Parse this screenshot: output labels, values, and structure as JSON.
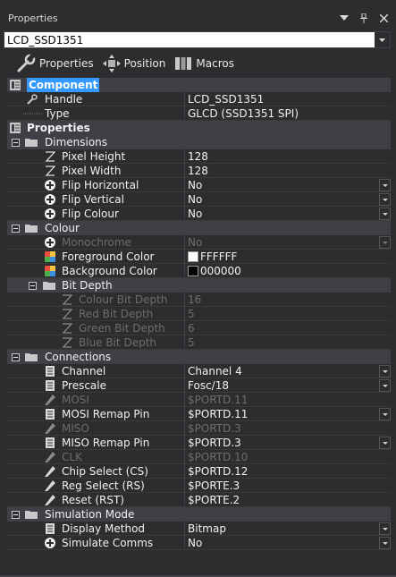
{
  "window": {
    "title": "Properties"
  },
  "selector": {
    "value": "LCD_SSD1351"
  },
  "toolbar": {
    "properties": "Properties",
    "position": "Position",
    "macros": "Macros"
  },
  "component": {
    "label": "Component",
    "handle": {
      "name": "Handle",
      "value": "LCD_SSD1351"
    },
    "type": {
      "name": "Type",
      "value": "GLCD (SSD1351 SPI)"
    }
  },
  "properties": {
    "label": "Properties"
  },
  "dimensions": {
    "label": "Dimensions",
    "pixel_height": {
      "name": "Pixel Height",
      "value": "128"
    },
    "pixel_width": {
      "name": "Pixel Width",
      "value": "128"
    },
    "flip_horizontal": {
      "name": "Flip Horizontal",
      "value": "No"
    },
    "flip_vertical": {
      "name": "Flip Vertical",
      "value": "No"
    },
    "flip_colour": {
      "name": "Flip Colour",
      "value": "No"
    }
  },
  "colour": {
    "label": "Colour",
    "monochrome": {
      "name": "Monochrome",
      "value": "No"
    },
    "foreground": {
      "name": "Foreground Color",
      "value": "FFFFFF",
      "swatch": "#ffffff"
    },
    "background": {
      "name": "Background Color",
      "value": "000000",
      "swatch": "#000000"
    }
  },
  "bit_depth": {
    "label": "Bit Depth",
    "colour": {
      "name": "Colour Bit Depth",
      "value": "16"
    },
    "red": {
      "name": "Red Bit Depth",
      "value": "5"
    },
    "green": {
      "name": "Green Bit Depth",
      "value": "6"
    },
    "blue": {
      "name": "Blue Bit Depth",
      "value": "5"
    }
  },
  "connections": {
    "label": "Connections",
    "channel": {
      "name": "Channel",
      "value": "Channel 4"
    },
    "prescale": {
      "name": "Prescale",
      "value": "Fosc/18"
    },
    "mosi": {
      "name": "MOSI",
      "value": "$PORTD.11"
    },
    "mosi_remap": {
      "name": "MOSI Remap Pin",
      "value": "$PORTD.11"
    },
    "miso": {
      "name": "MISO",
      "value": "$PORTD.3"
    },
    "miso_remap": {
      "name": "MISO Remap Pin",
      "value": "$PORTD.3"
    },
    "clk": {
      "name": "CLK",
      "value": "$PORTD.10"
    },
    "cs": {
      "name": "Chip Select (CS)",
      "value": "$PORTD.12"
    },
    "rs": {
      "name": "Reg Select (RS)",
      "value": "$PORTE.3"
    },
    "rst": {
      "name": "Reset (RST)",
      "value": "$PORTE.2"
    }
  },
  "simulation": {
    "label": "Simulation Mode",
    "display_method": {
      "name": "Display Method",
      "value": "Bitmap"
    },
    "simulate_comms": {
      "name": "Simulate Comms",
      "value": "No"
    }
  },
  "colors": {
    "background": "#2d2d30",
    "category": "#3f3f46",
    "selection": "#3399ff",
    "disabled": "#6d6d6d"
  }
}
